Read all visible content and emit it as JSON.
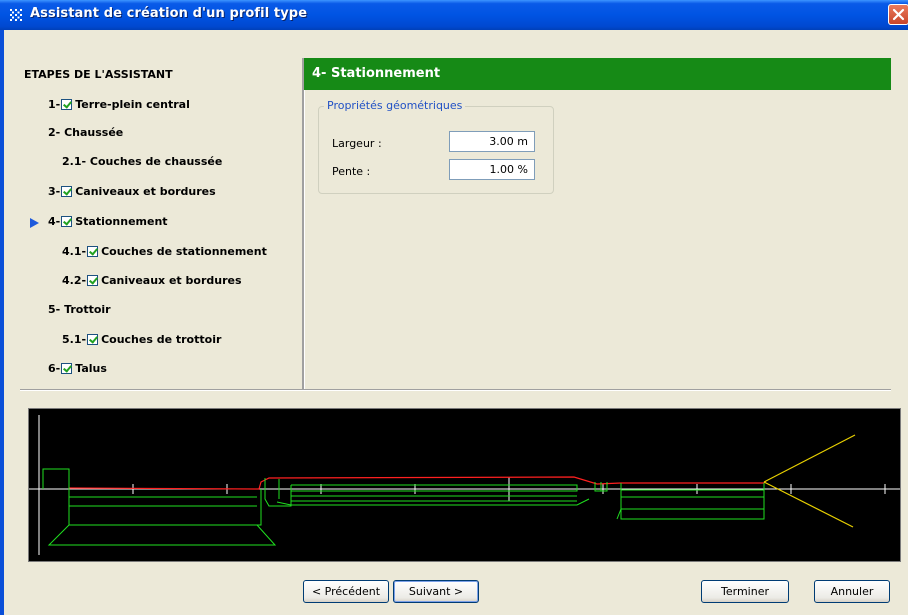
{
  "window": {
    "title": "Assistant de création d'un profil type"
  },
  "steps": {
    "heading": "ETAPES DE L'ASSISTANT",
    "items": [
      {
        "num": "1-",
        "label": "Terre-plein central",
        "checked": true
      },
      {
        "num": "2- ",
        "label": "Chaussée",
        "checked": false
      },
      {
        "num": "2.1- ",
        "label": "Couches de chaussée",
        "checked": false
      },
      {
        "num": "3-",
        "label": "Caniveaux et bordures",
        "checked": true
      },
      {
        "num": "4-",
        "label": "Stationnement",
        "checked": true,
        "current": true
      },
      {
        "num": "4.1-",
        "label": "Couches de stationnement",
        "checked": true
      },
      {
        "num": "4.2-",
        "label": "Caniveaux et bordures",
        "checked": true
      },
      {
        "num": "5- ",
        "label": "Trottoir",
        "checked": false
      },
      {
        "num": "5.1-",
        "label": "Couches de trottoir",
        "checked": true
      },
      {
        "num": "6-",
        "label": "Talus",
        "checked": true
      }
    ]
  },
  "panel": {
    "title": "4- Stationnement",
    "group_title": "Propriétés géométriques",
    "fields": [
      {
        "label": "Largeur :",
        "value": "3.00 m"
      },
      {
        "label": "Pente :",
        "value": "1.00 %"
      }
    ]
  },
  "buttons": {
    "prev": "< Précédent",
    "next": "Suivant >",
    "finish": "Terminer",
    "cancel": "Annuler"
  },
  "colors": {
    "header_green": "#168a16",
    "profile_red": "#ff2020",
    "layers_green": "#1fe01f",
    "slope_yellow": "#e8d000",
    "axis_white": "#ffffff"
  }
}
